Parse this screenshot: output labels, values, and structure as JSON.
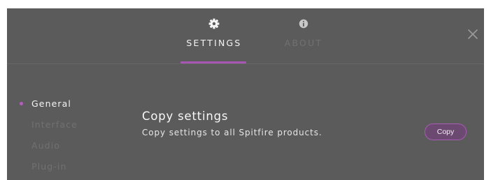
{
  "tabs": [
    {
      "label": "SETTINGS",
      "icon": "gear-icon",
      "active": true
    },
    {
      "label": "ABOUT",
      "icon": "info-icon",
      "active": false
    }
  ],
  "close_icon": "close-icon",
  "sidebar": {
    "items": [
      {
        "label": "General",
        "active": true
      },
      {
        "label": "Interface",
        "active": false
      },
      {
        "label": "Audio",
        "active": false
      },
      {
        "label": "Plug-in",
        "active": false
      }
    ]
  },
  "section": {
    "title": "Copy settings",
    "description": "Copy settings to all Spitfire products.",
    "button_label": "Copy"
  },
  "colors": {
    "background": "#5b5b5b",
    "accent": "#a855b5",
    "text_active": "#f4f4f4",
    "text_inactive": "#717171"
  }
}
